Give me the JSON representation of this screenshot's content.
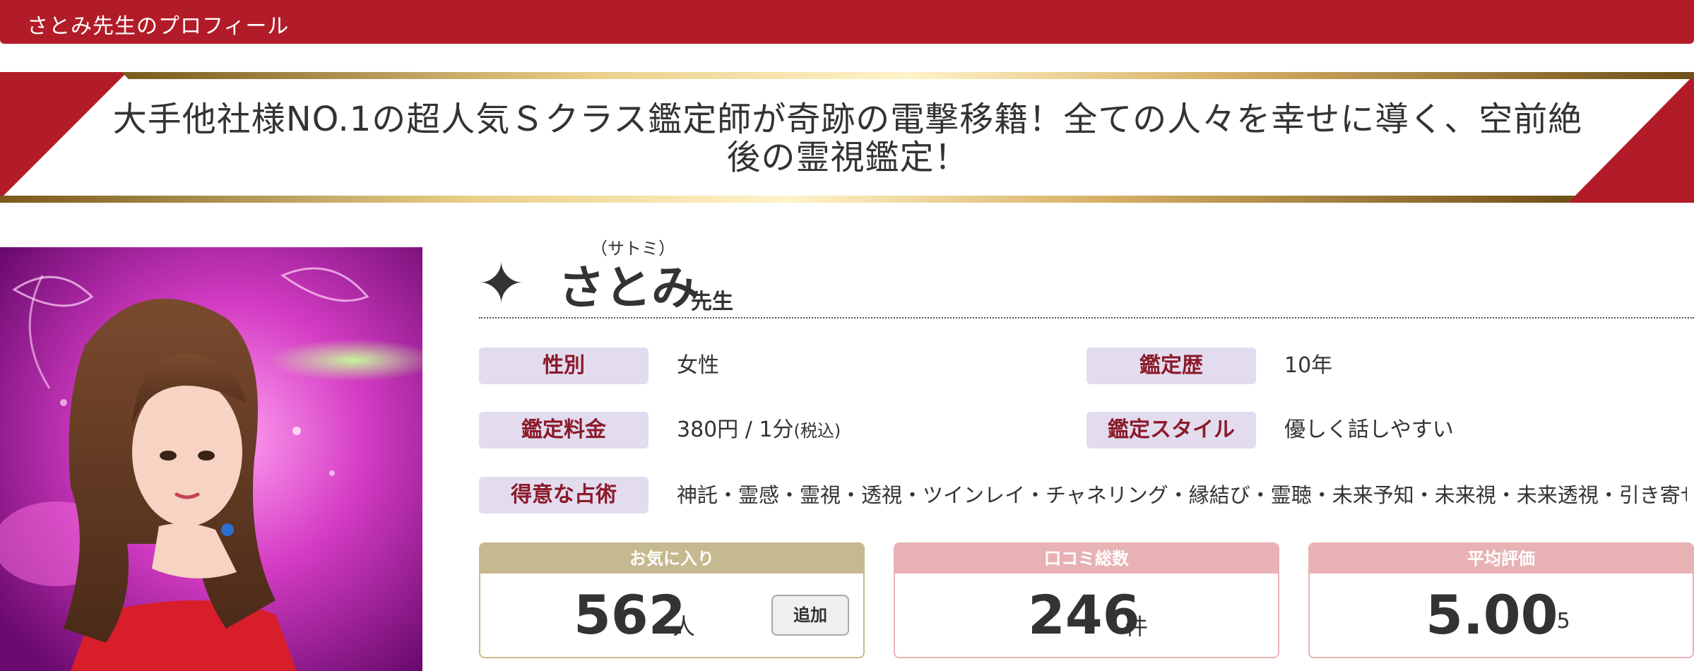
{
  "header": {
    "title": "さとみ先生のプロフィール"
  },
  "banner": {
    "line1": "大手他社様NO.1の超人気Ｓクラス鑑定師が奇跡の電撃移籍！全ての人々を幸せに導く、空前絶",
    "line2": "後の霊視鑑定！"
  },
  "profile": {
    "name_reading": "（サトミ）",
    "name": "さとみ",
    "name_suffix": "先生",
    "star_icon": "sparkle-star-icon",
    "fields": {
      "gender_label": "性別",
      "gender_value": "女性",
      "history_label": "鑑定歴",
      "history_value": "10年",
      "fee_label": "鑑定料金",
      "fee_value": "380円 / 1分",
      "fee_tax": "(税込)",
      "style_label": "鑑定スタイル",
      "style_value": "優しく話しやすい",
      "specialty_label": "得意な占術",
      "specialty_value": "神託・霊感・霊視・透視・ツインレイ・チャネリング・縁結び・霊聴・未来予知・未来視・未来透視・引き寄せ・…"
    }
  },
  "stats": {
    "favorites": {
      "label": "お気に入り",
      "value": "562",
      "unit": "人",
      "button": "追加"
    },
    "reviews": {
      "label": "口コミ総数",
      "value": "246",
      "unit": "件"
    },
    "rating": {
      "label": "平均評価",
      "value": "5.00",
      "unit": "/ 5"
    }
  },
  "colors": {
    "header_red": "#b21c28",
    "label_bg": "#e3dcef",
    "label_text": "#8b1a2a",
    "favorites_head": "#c5b98f",
    "reviews_head": "#e8b2b5",
    "gold": "#c9a35a"
  }
}
